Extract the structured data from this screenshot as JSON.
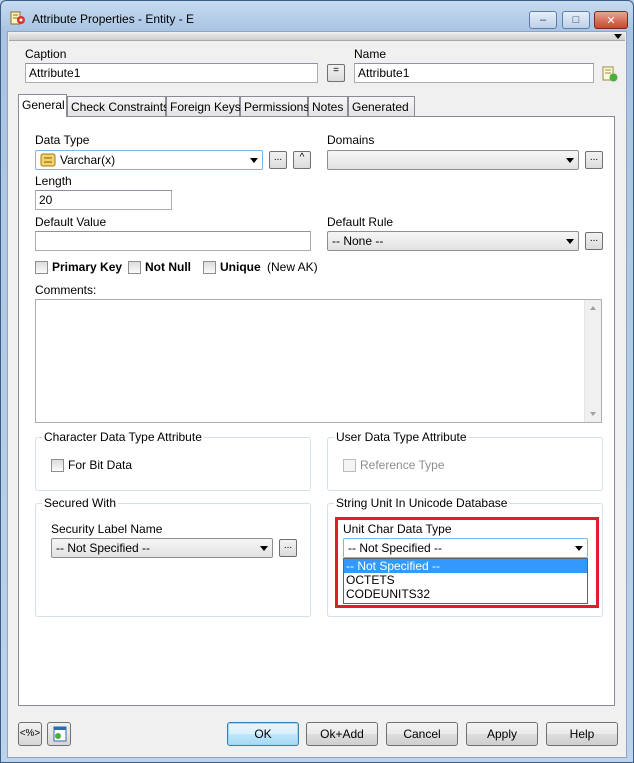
{
  "window": {
    "title": "Attribute Properties - Entity - E"
  },
  "caption": {
    "label": "Caption",
    "value": "Attribute1"
  },
  "name": {
    "label": "Name",
    "value": "Attribute1"
  },
  "equal_button": "=",
  "tabs": [
    {
      "label": "General"
    },
    {
      "label": "Check Constraints"
    },
    {
      "label": "Foreign Keys"
    },
    {
      "label": "Permissions"
    },
    {
      "label": "Notes"
    },
    {
      "label": "Generated"
    }
  ],
  "general": {
    "data_type": {
      "label": "Data Type",
      "value": "Varchar(x)"
    },
    "domains": {
      "label": "Domains",
      "value": ""
    },
    "length": {
      "label": "Length",
      "value": "20"
    },
    "default_value": {
      "label": "Default Value",
      "value": ""
    },
    "default_rule": {
      "label": "Default Rule",
      "value": "-- None --"
    },
    "checkboxes": {
      "primary_key": "Primary Key",
      "not_null": "Not Null",
      "unique": "Unique",
      "new_ak": "(New AK)"
    },
    "comments_label": "Comments:",
    "char_group": {
      "title": "Character Data Type Attribute",
      "for_bit_data": "For Bit Data"
    },
    "user_group": {
      "title": "User Data Type Attribute",
      "reference_type": "Reference Type"
    },
    "secured_group": {
      "title": "Secured With",
      "security_label_name": "Security Label Name",
      "security_value": "-- Not Specified --"
    },
    "string_unit_group": {
      "title": "String Unit In Unicode Database",
      "unit_label": "Unit Char Data Type",
      "unit_value": "-- Not Specified --",
      "options": [
        "-- Not Specified --",
        "OCTETS",
        "CODEUNITS32"
      ],
      "selected_option": "-- Not Specified --"
    }
  },
  "ellipsis": "...",
  "caret": "^",
  "buttons": {
    "ok": "OK",
    "ok_add": "Ok+Add",
    "cancel": "Cancel",
    "apply": "Apply",
    "help": "Help"
  },
  "icons": {
    "app": "attribute-properties-icon",
    "name_side": "edit-name-icon",
    "data_type": "varchar-type-icon",
    "bottom_left_1": "view-code-icon",
    "bottom_left_2": "properties-icon"
  },
  "colors": {
    "highlight": "#e01e2a",
    "selection": "#3399ff"
  }
}
